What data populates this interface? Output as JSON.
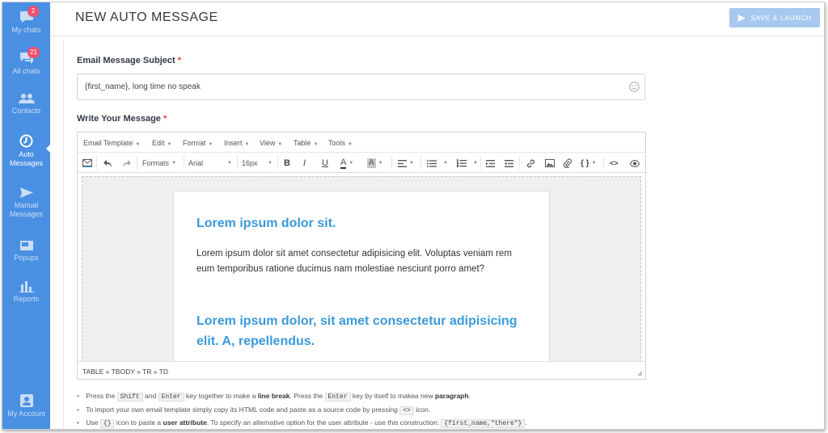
{
  "sidebar": {
    "items": [
      {
        "label": "My chats",
        "badge": "2",
        "icon": "chat-bubble-icon"
      },
      {
        "label": "All chats",
        "badge": "21",
        "icon": "chat-bubbles-icon"
      },
      {
        "label": "Contacts",
        "icon": "contacts-icon"
      },
      {
        "label": "Auto Messages",
        "icon": "auto-messages-icon",
        "active": true
      },
      {
        "label": "Manual Messages",
        "icon": "send-icon"
      },
      {
        "label": "Popups",
        "icon": "popup-icon"
      },
      {
        "label": "Reports",
        "icon": "bar-chart-icon"
      }
    ],
    "account": {
      "label": "My Account",
      "icon": "account-icon"
    }
  },
  "header": {
    "title": "NEW AUTO MESSAGE",
    "save_label": "SAVE & LAUNCH"
  },
  "form": {
    "subject_label": "Email Message Subject",
    "subject_value": "{first_name}, long time no speak",
    "message_label": "Write Your Message",
    "required_mark": "*"
  },
  "editor": {
    "menus": [
      "Email Template",
      "Edit",
      "Format",
      "Insert",
      "View",
      "Table",
      "Tools"
    ],
    "toolbar": {
      "formats": "Formats",
      "font": "Arial",
      "size": "16px",
      "bold": "B",
      "italic": "I",
      "underline": "U",
      "font_color": "A",
      "bg_color": "A",
      "braces": "{ }",
      "source": "<>"
    },
    "content": {
      "heading1": "Lorem ipsum dolor sit.",
      "paragraph": "Lorem ipsum dolor sit amet consectetur adipisicing elit. Voluptas veniam rem eum temporibus ratione ducimus nam molestiae nesciunt porro amet?",
      "heading2": "Lorem ipsum dolor, sit amet consectetur adipisicing elit. A, repellendus."
    },
    "statusbar": "TABLE » TBODY » TR » TD"
  },
  "hints": {
    "h1_a": "Press the",
    "h1_k1": "Shift",
    "h1_b": "and",
    "h1_k2": "Enter",
    "h1_c": "key together to make a",
    "h1_s1": "line break",
    "h1_d": ". Press the",
    "h1_k3": "Enter",
    "h1_e": "key by itself to makea new",
    "h1_s2": "paragraph",
    "h1_f": ".",
    "h2_a": "To import your own email template simply copy its HTML code and paste as a source code by pressing",
    "h2_k": "<>",
    "h2_b": "icon.",
    "h3_a": "Use",
    "h3_k": "{}",
    "h3_b": "icon to paste a",
    "h3_s": "user attribute",
    "h3_c": ". To specify an alternative option for the user attribute - use this construction:",
    "h3_k2": "{first_name,\"there\"}",
    "h3_d": "."
  },
  "colors": {
    "sidebar": "#4a90e2",
    "accent": "#3a9ad9",
    "badge": "#f0506e",
    "save_button": "#a7c8f0"
  }
}
